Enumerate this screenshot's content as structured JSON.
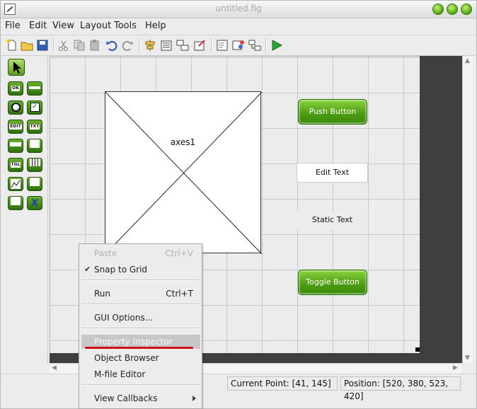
{
  "window": {
    "title": "untitled.fig"
  },
  "menubar": [
    {
      "label": "File"
    },
    {
      "label": "Edit"
    },
    {
      "label": "View"
    },
    {
      "label": "Layout"
    },
    {
      "label": "Tools"
    },
    {
      "label": "Help"
    }
  ],
  "toolbar": {
    "icons": [
      "new-icon",
      "open-icon",
      "save-icon",
      "cut-icon",
      "copy-icon",
      "paste-icon",
      "undo-icon",
      "redo-icon",
      "align-icon",
      "menu-editor-icon",
      "tab-order-icon",
      "editor-icon",
      "mfile-editor-icon",
      "property-inspector-icon",
      "object-browser-icon",
      "run-icon"
    ]
  },
  "palette": {
    "items": [
      {
        "name": "select",
        "label": ""
      },
      {
        "name": "push-button",
        "label": "OK"
      },
      {
        "name": "slider",
        "label": ""
      },
      {
        "name": "radio-button",
        "label": ""
      },
      {
        "name": "checkbox",
        "label": ""
      },
      {
        "name": "edit-text",
        "label": "EDIT"
      },
      {
        "name": "static-text",
        "label": "TXT"
      },
      {
        "name": "popup-menu",
        "label": ""
      },
      {
        "name": "listbox",
        "label": ""
      },
      {
        "name": "toggle-button",
        "label": "TGL"
      },
      {
        "name": "table",
        "label": ""
      },
      {
        "name": "axes",
        "label": ""
      },
      {
        "name": "panel",
        "label": ""
      },
      {
        "name": "button-group",
        "label": ""
      },
      {
        "name": "activex",
        "label": "X"
      }
    ]
  },
  "canvas": {
    "axes_label": "axes1",
    "push_button": "Push Button",
    "edit_text": "Edit Text",
    "static_text": "Static Text",
    "toggle_button": "Toggle Button"
  },
  "context_menu": {
    "paste": {
      "label": "Paste",
      "shortcut": "Ctrl+V"
    },
    "snap": {
      "label": "Snap to Grid",
      "checked": true
    },
    "run": {
      "label": "Run",
      "shortcut": "Ctrl+T"
    },
    "gui_options": {
      "label": "GUI Options..."
    },
    "property_inspector": {
      "label": "Property Inspector"
    },
    "object_browser": {
      "label": "Object Browser"
    },
    "mfile_editor": {
      "label": "M-file Editor"
    },
    "view_callbacks": {
      "label": "View Callbacks"
    }
  },
  "status": {
    "current_point_label": "Current Point:",
    "current_point_value": "[41, 145]",
    "position_label": "Position:",
    "position_value": "[520, 380, 523, 420]"
  },
  "colors": {
    "accent_green": "#4a9b12",
    "highlight_red": "#d0101a"
  }
}
